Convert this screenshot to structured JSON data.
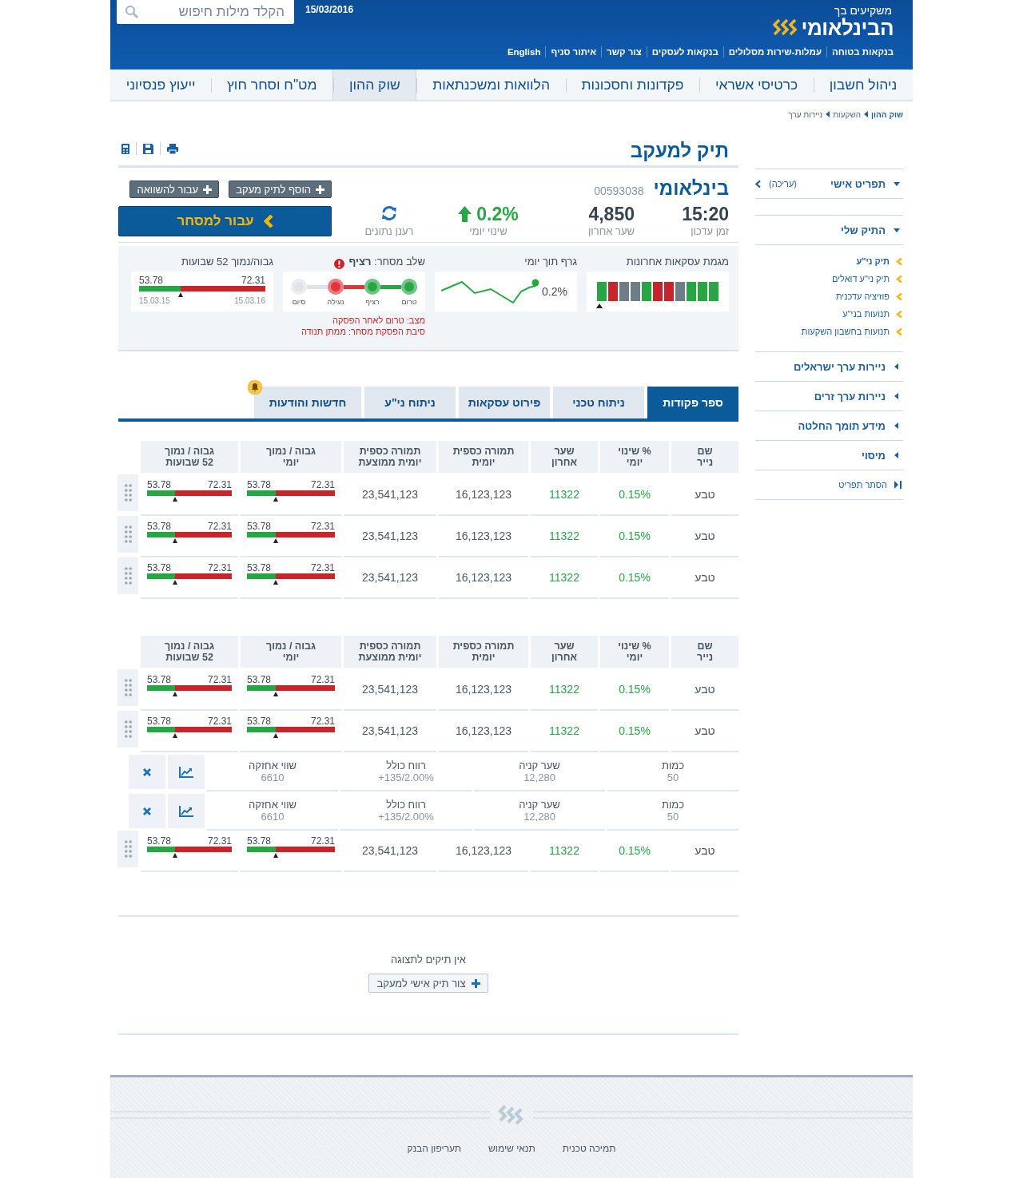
{
  "header": {
    "search_placeholder": "הקלד מילות חיפוש",
    "date": "15/03/2016",
    "tagline": "משקיעים בך",
    "logo_name": "הבינלאומי",
    "links": [
      "בנקאות בטוחה",
      "עמלות-שירות מסלולים",
      "בנקאות לעסקים",
      "צור קשר",
      "איתור סניף",
      "English"
    ]
  },
  "nav": [
    {
      "label": "ניהול חשבון",
      "selected": false
    },
    {
      "label": "כרטיסי אשראי",
      "selected": false
    },
    {
      "label": "פקדונות וחסכונות",
      "selected": false
    },
    {
      "label": "הלוואות ומשכנתאות",
      "selected": false
    },
    {
      "label": "שוק ההון",
      "selected": true
    },
    {
      "label": "מט\"ח וסחר חוץ",
      "selected": false
    },
    {
      "label": "ייעוץ פנסיוני",
      "selected": false
    }
  ],
  "breadcrumb": [
    "שוק ההון",
    "השקעות",
    "ניירות ערך"
  ],
  "sidebar": {
    "sections": [
      {
        "title": "תפריט אישי",
        "expanded": true,
        "action": "(עריכה)"
      },
      {
        "title": "התיק שלי",
        "expanded": true,
        "children": [
          {
            "label": "תיק ני\"ע",
            "selected": true
          },
          {
            "label": "תיק ני\"ע דואלים",
            "selected": false
          },
          {
            "label": "פוזיציה עדכנית",
            "selected": false
          },
          {
            "label": "תנועות בני\"ע",
            "selected": false
          },
          {
            "label": "תנועות בחשבון השקעות",
            "selected": false
          }
        ]
      },
      {
        "title": "ניירות ערך ישראלים",
        "expanded": false
      },
      {
        "title": "ניירות ערך זרים",
        "expanded": false
      },
      {
        "title": "מידע תומך החלטה",
        "expanded": false
      },
      {
        "title": "מיסוי",
        "expanded": false
      }
    ],
    "hide_menu": "הסתר תפריט"
  },
  "page_title": "תיק למעקב",
  "stock": {
    "name": "בינלאומי",
    "number": "00593038",
    "stats": [
      {
        "kind": "plain",
        "value": "15:20",
        "label": "זמן עדכון"
      },
      {
        "kind": "plain",
        "value": "4,850",
        "label": "שער אחרון"
      },
      {
        "kind": "up",
        "value": "0.2%",
        "label": "שינוי יומי"
      }
    ],
    "refresh_label": "רענן נתונים",
    "buttons": [
      "הוסף לתיק מעקב",
      "עבור להשוואה"
    ],
    "trade_button": "עבור למסחר"
  },
  "widgets": {
    "trend": {
      "title": "מגמת עסקאות אחרונות",
      "bars": [
        {
          "color": "#27a744"
        },
        {
          "color": "#27a744"
        },
        {
          "color": "#27a744"
        },
        {
          "color": "#6f7d89"
        },
        {
          "color": "#c8242c"
        },
        {
          "color": "#c8242c"
        },
        {
          "color": "#27a744"
        },
        {
          "color": "#6f7d89"
        },
        {
          "color": "#6f7d89"
        },
        {
          "color": "#c8242c"
        },
        {
          "color": "#27a744"
        }
      ]
    },
    "intraday": {
      "title": "גרף תוך יומי",
      "value": "0.2%"
    },
    "phase": {
      "title": "שלב מסחר: **רציף**",
      "steps": [
        {
          "label": "טרום",
          "color": "#27a744"
        },
        {
          "label": "רציף",
          "color": "#27a744"
        },
        {
          "label": "נעילה",
          "color": "#e0353b"
        },
        {
          "label": "סיום",
          "color": "#dfe3e8"
        }
      ],
      "notes": [
        "מצב: טרום לאחר הפסקה",
        "סיבת הפסקת מסחר: ממתן תנודה"
      ]
    },
    "range52": {
      "title": "גבוה/נמוך 52 שבועות",
      "low": "53.78",
      "high": "72.31",
      "level": 0.33,
      "from": "15.03.15",
      "to": "15.03.16"
    }
  },
  "tabs": [
    {
      "label": "ספר פקודות",
      "selected": true
    },
    {
      "label": "ניתוח טכני",
      "selected": false
    },
    {
      "label": "פירוט עסקאות",
      "selected": false
    },
    {
      "label": "ניתוח ני\"ע",
      "selected": false
    },
    {
      "label": "חדשות והודעות",
      "selected": false,
      "alert": true
    }
  ],
  "tables": [
    {
      "columns": [
        [
          "שם",
          "נייר"
        ],
        [
          "% שינוי",
          "יומי"
        ],
        [
          "שער",
          "אחרון"
        ],
        [
          "תמורה כספית",
          "יומית"
        ],
        [
          "תמורה כספית",
          "יומית ממוצעת"
        ],
        [
          "גבוה / נמוך",
          "יומי"
        ],
        [
          "גבוה / נמוך",
          "52 שבועות"
        ]
      ],
      "rows": [
        {
          "kind": "security",
          "name": "טבע",
          "change": "0.15%",
          "last": "11322",
          "turnover": "16,123,123",
          "avg_turnover": "23,541,123",
          "daily": {
            "low": "53.78",
            "high": "72.31",
            "level": 0.33
          },
          "weekly52": {
            "low": "53.78",
            "high": "72.31",
            "level": 0.33
          }
        },
        {
          "kind": "security",
          "name": "טבע",
          "change": "0.15%",
          "last": "11322",
          "turnover": "16,123,123",
          "avg_turnover": "23,541,123",
          "daily": {
            "low": "53.78",
            "high": "72.31",
            "level": 0.33
          },
          "weekly52": {
            "low": "53.78",
            "high": "72.31",
            "level": 0.33
          }
        },
        {
          "kind": "security",
          "name": "טבע",
          "change": "0.15%",
          "last": "11322",
          "turnover": "16,123,123",
          "avg_turnover": "23,541,123",
          "daily": {
            "low": "53.78",
            "high": "72.31",
            "level": 0.33
          },
          "weekly52": {
            "low": "53.78",
            "high": "72.31",
            "level": 0.33
          }
        }
      ]
    },
    {
      "columns": [
        [
          "שם",
          "נייר"
        ],
        [
          "% שינוי",
          "יומי"
        ],
        [
          "שער",
          "אחרון"
        ],
        [
          "תמורה כספית",
          "יומית"
        ],
        [
          "תמורה כספית",
          "יומית ממוצעת"
        ],
        [
          "גבוה / נמוך",
          "יומי"
        ],
        [
          "גבוה / נמוך",
          "52 שבועות"
        ]
      ],
      "rows": [
        {
          "kind": "security",
          "name": "טבע",
          "change": "0.15%",
          "last": "11322",
          "turnover": "16,123,123",
          "avg_turnover": "23,541,123",
          "daily": {
            "low": "53.78",
            "high": "72.31",
            "level": 0.33
          },
          "weekly52": {
            "low": "53.78",
            "high": "72.31",
            "level": 0.33
          }
        },
        {
          "kind": "security",
          "name": "טבע",
          "change": "0.15%",
          "last": "11322",
          "turnover": "16,123,123",
          "avg_turnover": "23,541,123",
          "daily": {
            "low": "53.78",
            "high": "72.31",
            "level": 0.33
          },
          "weekly52": {
            "low": "53.78",
            "high": "72.31",
            "level": 0.33
          }
        },
        {
          "kind": "holding",
          "fields": [
            {
              "label": "כמות",
              "value": "50"
            },
            {
              "label": "שער קניה",
              "value": "12,280"
            },
            {
              "label": "רווח כולל",
              "value": "+135/2.00%"
            },
            {
              "label": "שווי אחזקה",
              "value": "6610"
            }
          ]
        },
        {
          "kind": "holding",
          "fields": [
            {
              "label": "כמות",
              "value": "50"
            },
            {
              "label": "שער קניה",
              "value": "12,280"
            },
            {
              "label": "רווח כולל",
              "value": "+135/2.00%"
            },
            {
              "label": "שווי אחזקה",
              "value": "6610"
            }
          ]
        },
        {
          "kind": "security",
          "name": "טבע",
          "change": "0.15%",
          "last": "11322",
          "turnover": "16,123,123",
          "avg_turnover": "23,541,123",
          "daily": {
            "low": "53.78",
            "high": "72.31",
            "level": 0.33
          },
          "weekly52": {
            "low": "53.78",
            "high": "72.31",
            "level": 0.33
          }
        }
      ]
    }
  ],
  "empty": {
    "message": "אין תיקים לתצוגה",
    "button": "צור תיק אישי למעקב"
  },
  "footer": {
    "links": [
      "תמיכה טכנית",
      "תנאי שימוש",
      "תעריפון הבנק"
    ]
  }
}
